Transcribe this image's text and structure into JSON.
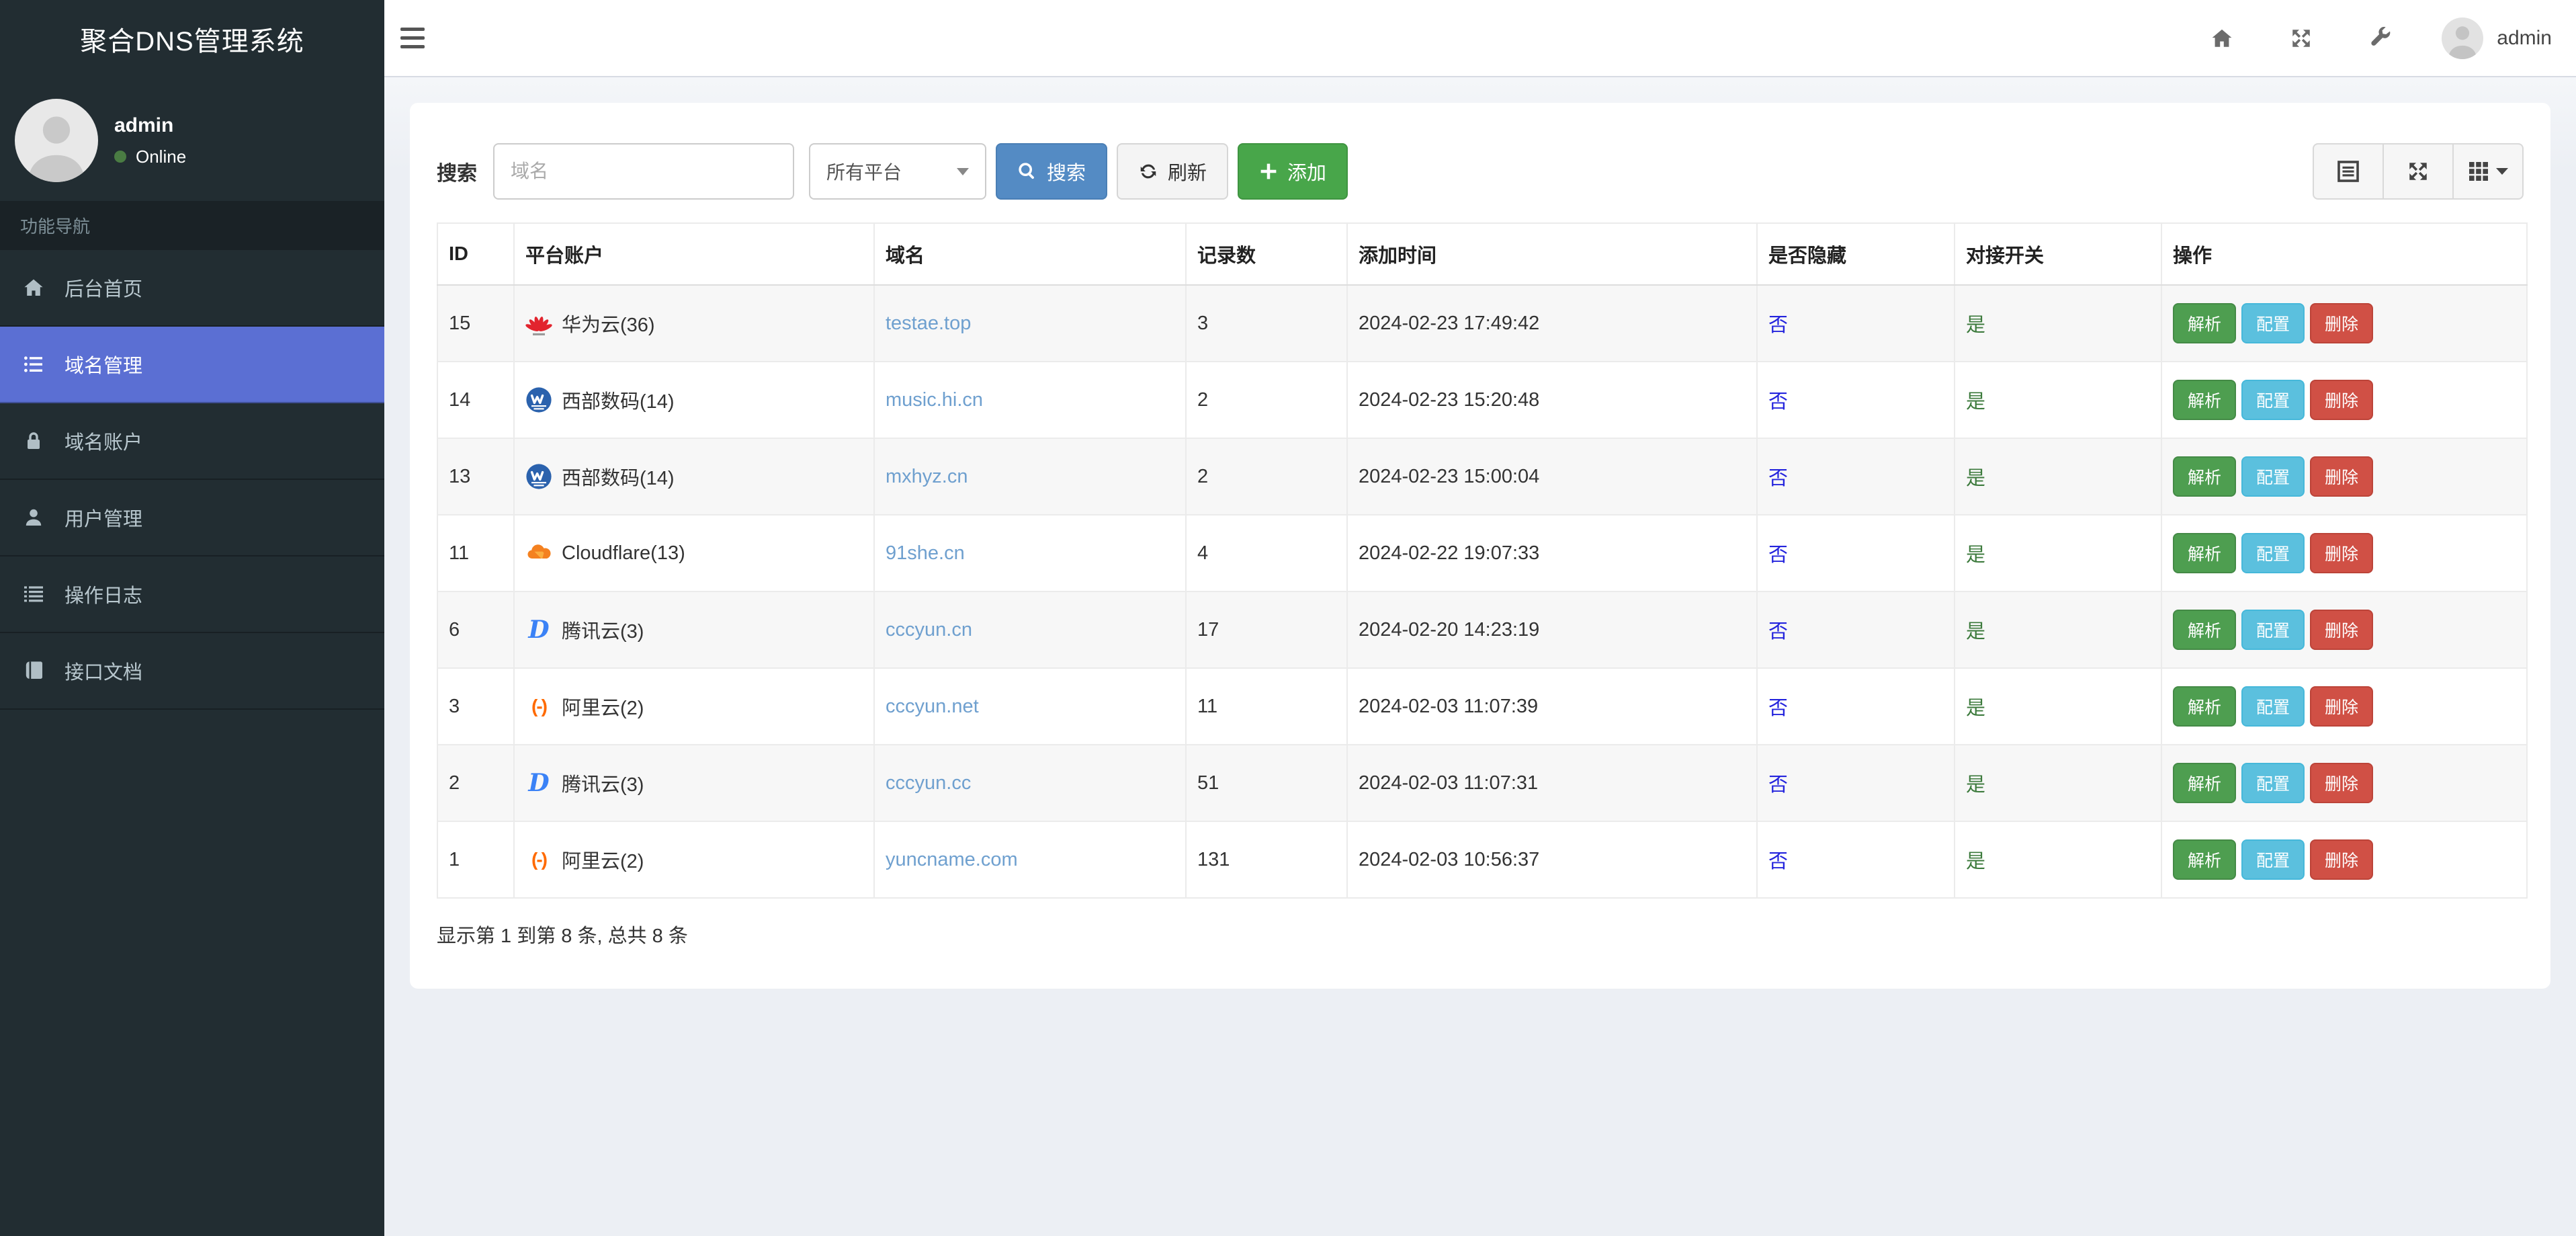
{
  "app": {
    "brand": "聚合DNS管理系统"
  },
  "navbar": {
    "username": "admin",
    "icons": [
      "home-icon",
      "fullscreen-icon",
      "wrench-icon"
    ]
  },
  "sidebar": {
    "user": {
      "name": "admin",
      "status": "Online"
    },
    "nav_header": "功能导航",
    "items": [
      {
        "label": "后台首页",
        "icon": "home-icon",
        "active": false
      },
      {
        "label": "域名管理",
        "icon": "list-icon",
        "active": true
      },
      {
        "label": "域名账户",
        "icon": "lock-icon",
        "active": false
      },
      {
        "label": "用户管理",
        "icon": "user-icon",
        "active": false
      },
      {
        "label": "操作日志",
        "icon": "log-icon",
        "active": false
      },
      {
        "label": "接口文档",
        "icon": "book-icon",
        "active": false
      }
    ]
  },
  "toolbar": {
    "search_label": "搜索",
    "search_placeholder": "域名",
    "search_value": "",
    "platform_select_value": "所有平台",
    "search_button": "搜索",
    "refresh_button": "刷新",
    "add_button": "添加",
    "view_buttons": [
      "detail-view-icon",
      "table-fullscreen-icon",
      "columns-grid-icon"
    ]
  },
  "table": {
    "columns": [
      "ID",
      "平台账户",
      "域名",
      "记录数",
      "添加时间",
      "是否隐藏",
      "对接开关",
      "操作"
    ],
    "action_labels": {
      "resolve": "解析",
      "config": "配置",
      "delete": "删除"
    },
    "rows": [
      {
        "id": "15",
        "platform": "华为云(36)",
        "platform_icon": "huawei-icon",
        "domain": "testae.top",
        "records": "3",
        "added": "2024-02-23 17:49:42",
        "hidden": "否",
        "switch": "是"
      },
      {
        "id": "14",
        "platform": "西部数码(14)",
        "platform_icon": "west-icon",
        "domain": "music.hi.cn",
        "records": "2",
        "added": "2024-02-23 15:20:48",
        "hidden": "否",
        "switch": "是"
      },
      {
        "id": "13",
        "platform": "西部数码(14)",
        "platform_icon": "west-icon",
        "domain": "mxhyz.cn",
        "records": "2",
        "added": "2024-02-23 15:00:04",
        "hidden": "否",
        "switch": "是"
      },
      {
        "id": "11",
        "platform": "Cloudflare(13)",
        "platform_icon": "cloudflare-icon",
        "domain": "91she.cn",
        "records": "4",
        "added": "2024-02-22 19:07:33",
        "hidden": "否",
        "switch": "是"
      },
      {
        "id": "6",
        "platform": "腾讯云(3)",
        "platform_icon": "dnspod-icon",
        "domain": "cccyun.cn",
        "records": "17",
        "added": "2024-02-20 14:23:19",
        "hidden": "否",
        "switch": "是"
      },
      {
        "id": "3",
        "platform": "阿里云(2)",
        "platform_icon": "aliyun-icon",
        "domain": "cccyun.net",
        "records": "11",
        "added": "2024-02-03 11:07:39",
        "hidden": "否",
        "switch": "是"
      },
      {
        "id": "2",
        "platform": "腾讯云(3)",
        "platform_icon": "dnspod-icon",
        "domain": "cccyun.cc",
        "records": "51",
        "added": "2024-02-03 11:07:31",
        "hidden": "否",
        "switch": "是"
      },
      {
        "id": "1",
        "platform": "阿里云(2)",
        "platform_icon": "aliyun-icon",
        "domain": "yuncname.com",
        "records": "131",
        "added": "2024-02-03 10:56:37",
        "hidden": "否",
        "switch": "是"
      }
    ],
    "pagination_info": "显示第 1 到第 8 条, 总共 8 条"
  },
  "colors": {
    "sidebar_bg": "#222d32",
    "sidebar_active": "#5b6fd3",
    "search_button": "#548bc4",
    "add_button": "#48a64a",
    "resolve_button": "#4e9e50",
    "config_button": "#5bc0de",
    "delete_button": "#d05045",
    "domain_link": "#6fa0cf",
    "hidden_link": "#2424dd",
    "switch_link": "#3c7a3c",
    "online_dot": "#4a7c43"
  }
}
